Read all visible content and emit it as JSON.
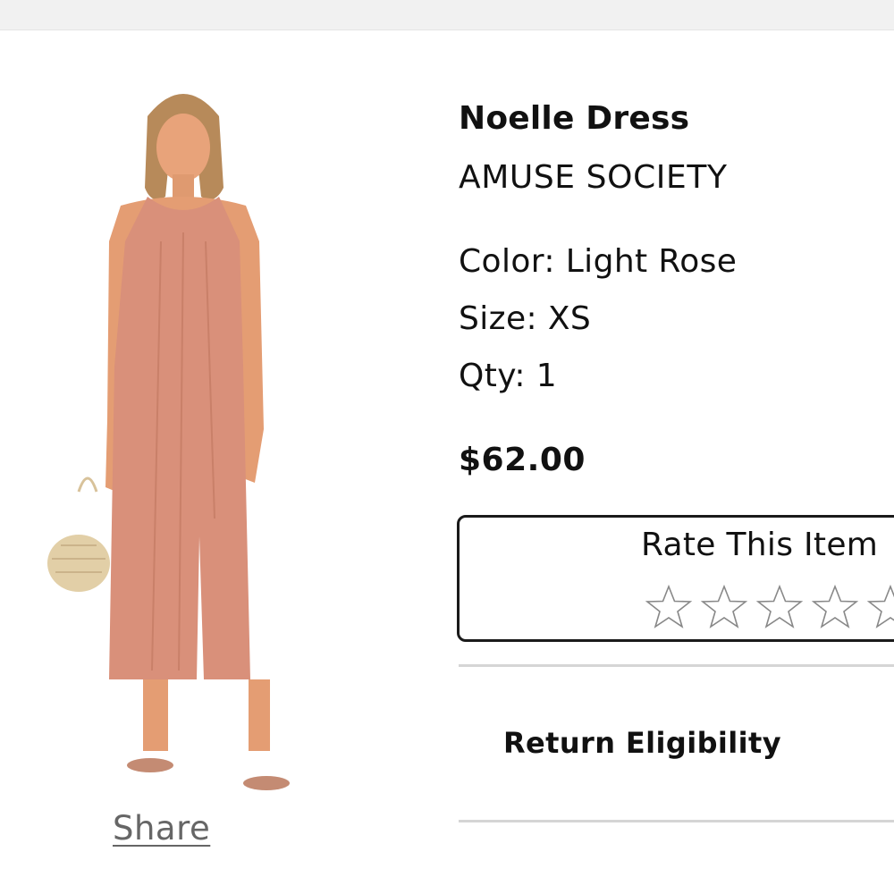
{
  "product": {
    "name": "Noelle Dress",
    "brand": "AMUSE SOCIETY",
    "color_line": "Color: Light Rose",
    "size_line": "Size: XS",
    "qty_line": "Qty: 1",
    "price": "$62.00",
    "image_icon": "product-photo"
  },
  "share": {
    "label": "Share"
  },
  "rating": {
    "title": "Rate This Item",
    "max_stars": 5,
    "current": 0
  },
  "return_eligibility": {
    "label": "Return Eligibility"
  },
  "colors": {
    "dress": "#d9907a",
    "text": "#111111",
    "muted": "#666666",
    "divider": "#d5d5d5",
    "topbar": "#f1f1f1"
  }
}
